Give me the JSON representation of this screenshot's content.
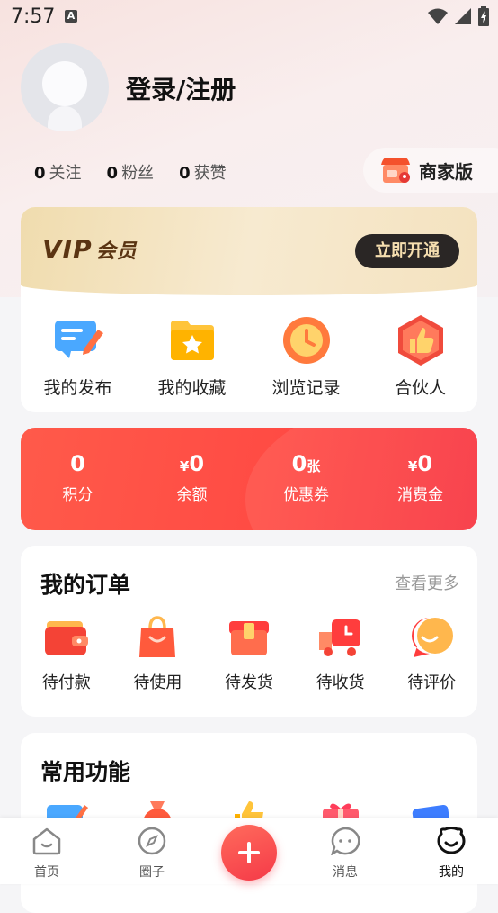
{
  "status_bar": {
    "time": "7:57",
    "notif_letter": "A"
  },
  "profile": {
    "login_label": "登录/注册"
  },
  "stats": [
    {
      "value": "0",
      "label": "关注"
    },
    {
      "value": "0",
      "label": "粉丝"
    },
    {
      "value": "0",
      "label": "获赞"
    }
  ],
  "merchant": {
    "label": "商家版"
  },
  "vip": {
    "logo": "VIP",
    "logo_suffix": "会员",
    "button": "立即开通"
  },
  "quick_actions": [
    {
      "label": "我的发布",
      "icon": "post-icon"
    },
    {
      "label": "我的收藏",
      "icon": "star-folder-icon"
    },
    {
      "label": "浏览记录",
      "icon": "clock-icon"
    },
    {
      "label": "合伙人",
      "icon": "thumbs-up-icon"
    }
  ],
  "wallet": [
    {
      "prefix": "",
      "value": "0",
      "suffix": "",
      "label": "积分"
    },
    {
      "prefix": "¥",
      "value": "0",
      "suffix": "",
      "label": "余额"
    },
    {
      "prefix": "",
      "value": "0",
      "suffix": "张",
      "label": "优惠券"
    },
    {
      "prefix": "¥",
      "value": "0",
      "suffix": "",
      "label": "消费金"
    }
  ],
  "orders": {
    "title": "我的订单",
    "more": "查看更多",
    "items": [
      {
        "label": "待付款",
        "icon": "wallet-icon"
      },
      {
        "label": "待使用",
        "icon": "shopping-bag-icon"
      },
      {
        "label": "待发货",
        "icon": "package-icon"
      },
      {
        "label": "待收货",
        "icon": "truck-icon"
      },
      {
        "label": "待评价",
        "icon": "chat-bubble-icon"
      }
    ]
  },
  "common": {
    "title": "常用功能"
  },
  "tabbar": [
    {
      "label": "首页",
      "icon": "home-icon"
    },
    {
      "label": "圈子",
      "icon": "compass-icon"
    },
    {
      "label": "消息",
      "icon": "message-icon"
    },
    {
      "label": "我的",
      "icon": "profile-icon"
    }
  ],
  "colors": {
    "accent": "#f53a48",
    "vip_gold": "#f0dcae",
    "vip_dark": "#2a2625"
  }
}
